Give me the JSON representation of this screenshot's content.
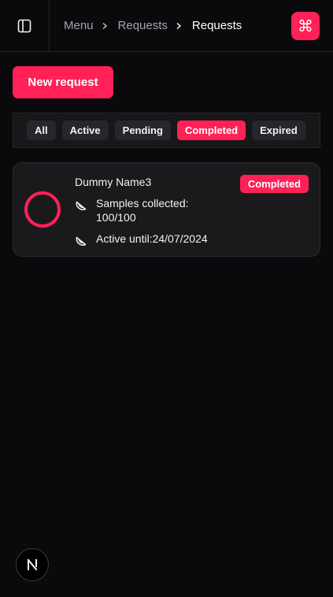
{
  "header": {
    "breadcrumb": [
      "Menu",
      "Requests",
      "Requests"
    ],
    "command_key_icon": "⌘"
  },
  "actions": {
    "new_request_label": "New request"
  },
  "filters": {
    "items": [
      "All",
      "Active",
      "Pending",
      "Completed",
      "Expired"
    ],
    "selected": "Completed"
  },
  "requests": [
    {
      "name": "Dummy Name3",
      "status": "Completed",
      "samples_label": "Samples collected:",
      "samples_value": "100/100",
      "active_label": "Active until:24/07/2024"
    }
  ],
  "colors": {
    "accent": "#ff2157",
    "background": "#0a0a0c",
    "card": "#1a1a1d"
  },
  "icons": {
    "sidebar": "sidebar-panel-icon",
    "chevron": "chevron-right-icon",
    "command": "command-icon",
    "watermelon": "watermelon-slice-icon",
    "next": "nextjs-logo-icon"
  }
}
